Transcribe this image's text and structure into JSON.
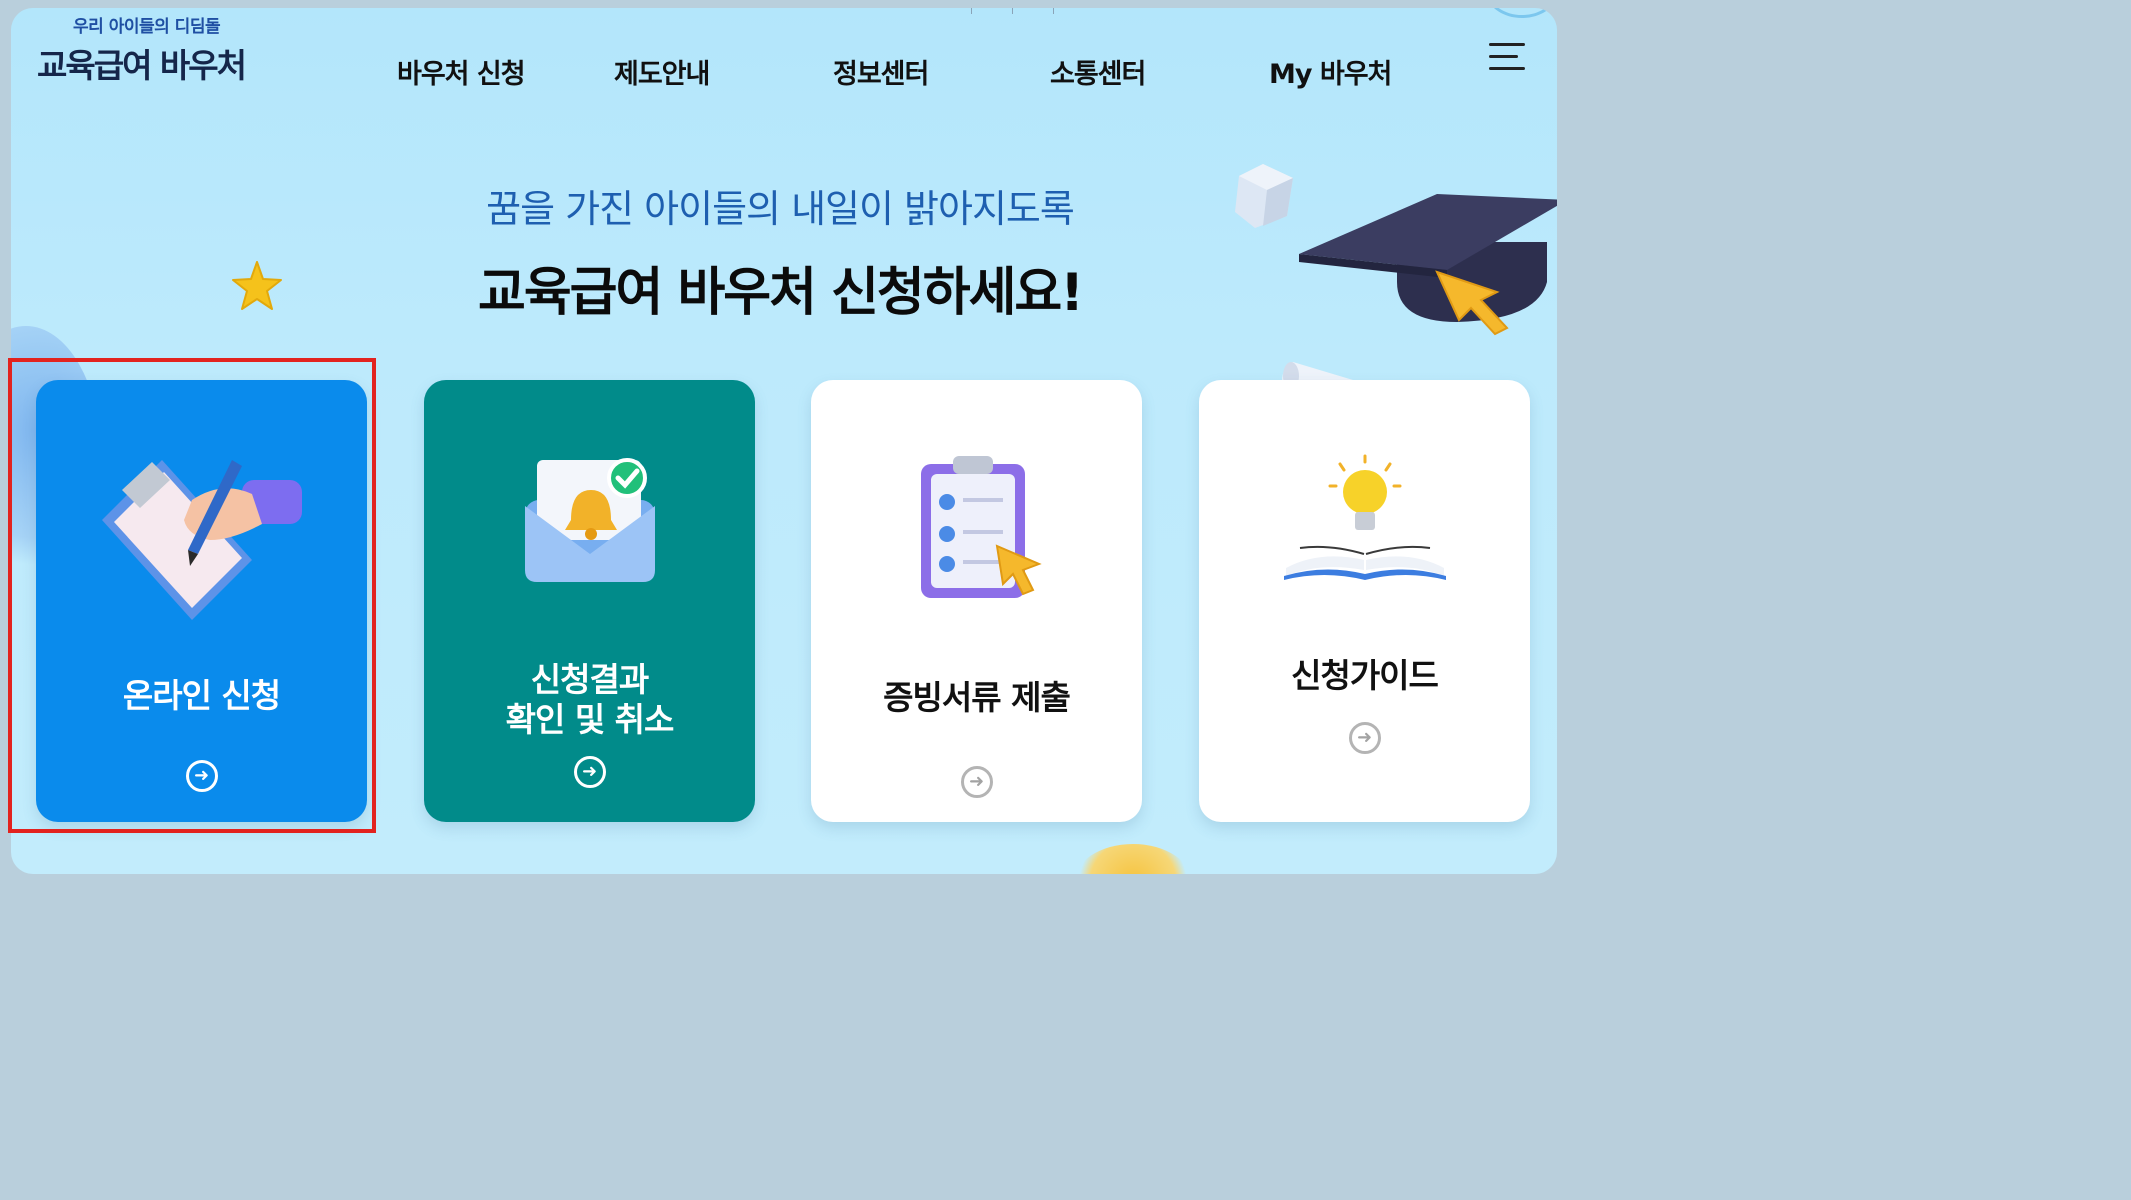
{
  "header": {
    "logo_sub": "우리 아이들의 디딤돌",
    "logo_main": "교육급여 바우처",
    "nav": [
      {
        "label": "바우처 신청"
      },
      {
        "label": "제도안내"
      },
      {
        "label": "정보센터"
      },
      {
        "label": "소통센터"
      },
      {
        "label": "My 바우처"
      }
    ],
    "menu_icon": "hamburger-menu-icon"
  },
  "hero": {
    "subtitle": "꿈을 가진 아이들의 내일이 밝아지도록",
    "title": "교육급여 바우처 신청하세요!"
  },
  "cards": [
    {
      "label": "온라인 신청",
      "icon": "clipboard-writing-icon",
      "color": "#0a8bec",
      "highlighted": true
    },
    {
      "label": "신청결과",
      "label2": "확인 및 취소",
      "icon": "mail-bell-check-icon",
      "color": "#018b8a"
    },
    {
      "label": "증빙서류 제출",
      "icon": "checklist-clipboard-icon",
      "color": "#ffffff"
    },
    {
      "label": "신청가이드",
      "icon": "lightbulb-book-icon",
      "color": "#ffffff"
    }
  ],
  "arrow_glyph": "➜",
  "colors": {
    "highlight": "#e2231f",
    "accent_blue": "#0a8bec",
    "accent_teal": "#018b8a"
  }
}
